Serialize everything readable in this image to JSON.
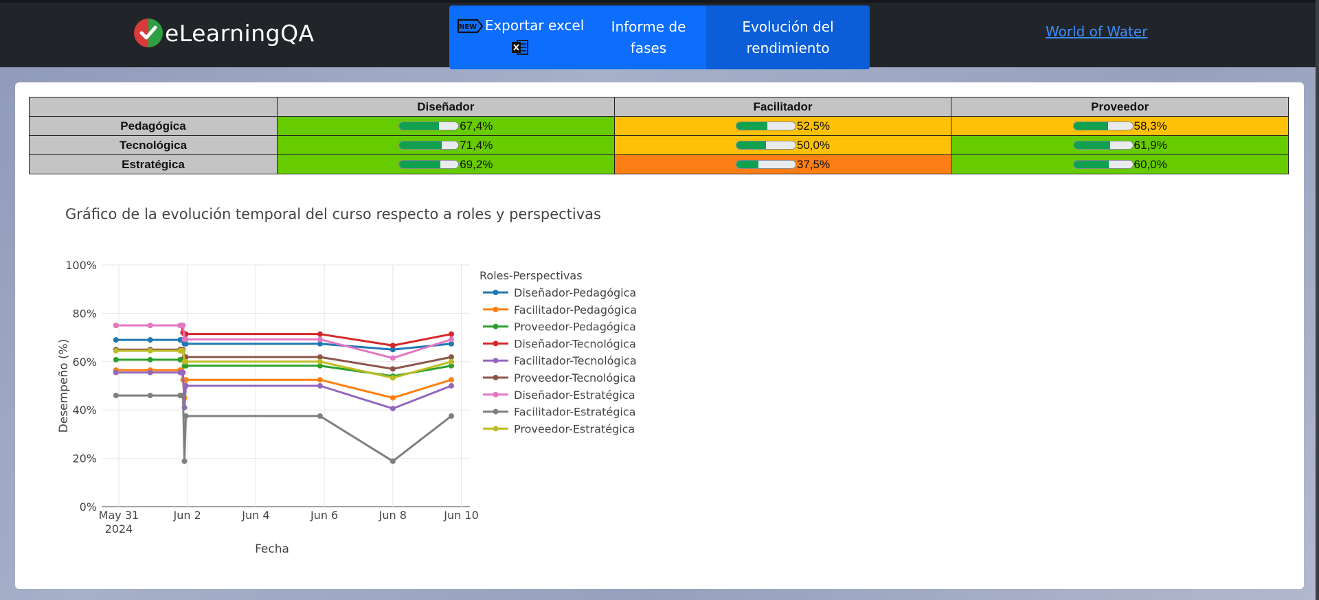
{
  "header": {
    "app_name": "eLearningQA",
    "export_label": "Exportar excel",
    "new_badge": "NEW",
    "fases_label_line1": "Informe de",
    "fases_label_line2": "fases",
    "evolucion_label_line1": "Evolución del",
    "evolucion_label_line2": "rendimiento",
    "world_link": "World of Water"
  },
  "table": {
    "columns": [
      "Diseñador",
      "Facilitador",
      "Proveedor"
    ],
    "rows": [
      {
        "label": "Pedagógica",
        "cells": [
          {
            "value": 67.4,
            "text": "67,4%",
            "color": "#66cc00"
          },
          {
            "value": 52.5,
            "text": "52,5%",
            "color": "#ffc107"
          },
          {
            "value": 58.3,
            "text": "58,3%",
            "color": "#ffc107"
          }
        ]
      },
      {
        "label": "Tecnológica",
        "cells": [
          {
            "value": 71.4,
            "text": "71,4%",
            "color": "#66cc00"
          },
          {
            "value": 50.0,
            "text": "50,0%",
            "color": "#ffc107"
          },
          {
            "value": 61.9,
            "text": "61,9%",
            "color": "#66cc00"
          }
        ]
      },
      {
        "label": "Estratégica",
        "cells": [
          {
            "value": 69.2,
            "text": "69,2%",
            "color": "#66cc00"
          },
          {
            "value": 37.5,
            "text": "37,5%",
            "color": "#fd7e14"
          },
          {
            "value": 60.0,
            "text": "60,0%",
            "color": "#66cc00"
          }
        ]
      }
    ]
  },
  "chart_data": {
    "type": "line",
    "title": "Gráfico de la evolución temporal del curso respecto a roles y perspectivas",
    "xlabel": "Fecha",
    "ylabel": "Desempeño (%)",
    "ylim": [
      0,
      100
    ],
    "yticks": [
      0,
      20,
      40,
      60,
      80,
      100
    ],
    "ytick_labels": [
      "0%",
      "20%",
      "40%",
      "60%",
      "80%",
      "100%"
    ],
    "xlim": [
      "2024-05-30T12:00",
      "2024-06-10T06:00"
    ],
    "xticks": [
      "2024-05-31",
      "2024-06-02",
      "2024-06-04",
      "2024-06-06",
      "2024-06-08",
      "2024-06-10"
    ],
    "xtick_labels": [
      "May 31",
      "Jun 2",
      "Jun 4",
      "Jun 6",
      "Jun 8",
      "Jun 10"
    ],
    "xtick_sublabel": "2024",
    "grid": true,
    "legend_title": "Roles-Perspectivas",
    "legend_position": "right",
    "x": [
      "2024-05-30T22:00",
      "2024-05-31T22:00",
      "2024-06-01T19:00",
      "2024-06-01T20:00",
      "2024-06-01T21:00",
      "2024-06-01T22:00",
      "2024-06-01T23:00",
      "2024-06-05T21:00",
      "2024-06-08T00:00",
      "2024-06-09T17:00"
    ],
    "series": [
      {
        "name": "Diseñador-Pedagógica",
        "color": "#1f77b4",
        "values": [
          69,
          69,
          69,
          69,
          69,
          67.4,
          67.4,
          67.4,
          65,
          67.4
        ]
      },
      {
        "name": "Facilitador-Pedagógica",
        "color": "#ff7f0e",
        "values": [
          56.5,
          56.5,
          56.5,
          56.5,
          52.5,
          45,
          52.5,
          52.5,
          45,
          52.5
        ]
      },
      {
        "name": "Proveedor-Pedagógica",
        "color": "#2ca02c",
        "values": [
          60.8,
          60.8,
          60.8,
          60.8,
          60.8,
          58.3,
          58.3,
          58.3,
          54,
          58.3
        ]
      },
      {
        "name": "Diseñador-Tecnológica",
        "color": "#d62728",
        "values": [
          75,
          75,
          75,
          75,
          72,
          71.4,
          71.4,
          71.4,
          66.7,
          71.4
        ]
      },
      {
        "name": "Facilitador-Tecnológica",
        "color": "#9467bd",
        "values": [
          55.5,
          55.5,
          55.5,
          55.5,
          55.5,
          41,
          50,
          50,
          40.6,
          50
        ]
      },
      {
        "name": "Proveedor-Tecnológica",
        "color": "#8c564b",
        "values": [
          65,
          65,
          65,
          65,
          65,
          61.9,
          61.9,
          61.9,
          57,
          61.9
        ]
      },
      {
        "name": "Diseñador-Estratégica",
        "color": "#e377c2",
        "values": [
          75,
          75,
          75,
          75,
          75,
          69.2,
          69.2,
          69.2,
          61.5,
          69.2
        ]
      },
      {
        "name": "Facilitador-Estratégica",
        "color": "#7f7f7f",
        "values": [
          46,
          46,
          46,
          46,
          46,
          18.8,
          37.5,
          37.5,
          18.8,
          37.5
        ]
      },
      {
        "name": "Proveedor-Estratégica",
        "color": "#bcbd22",
        "values": [
          64.5,
          64.5,
          64.5,
          64.5,
          64.5,
          60,
          60,
          60,
          53.3,
          60
        ]
      }
    ]
  }
}
